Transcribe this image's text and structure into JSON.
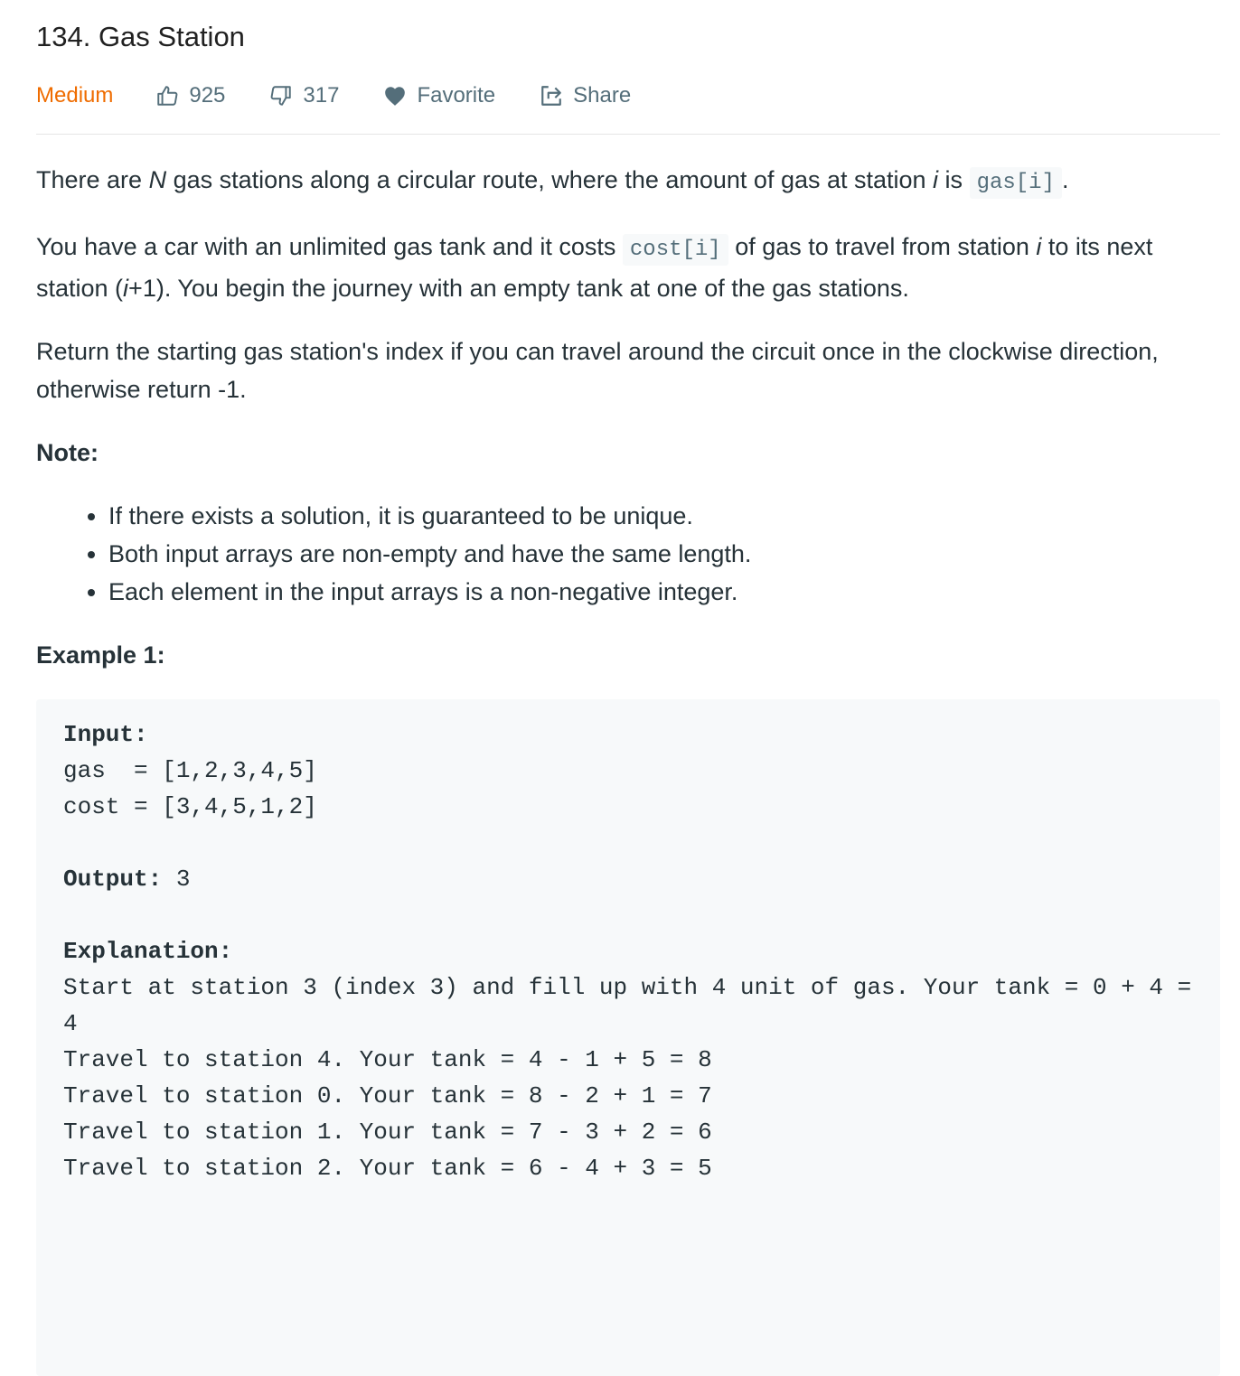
{
  "problem": {
    "title": "134. Gas Station",
    "difficulty": "Medium",
    "likes": "925",
    "dislikes": "317",
    "favorite_label": "Favorite",
    "share_label": "Share",
    "difficulty_color": "#ef6c00"
  },
  "description": {
    "p1_pre": "There are ",
    "p1_n": "N",
    "p1_mid": " gas stations along a circular route, where the amount of gas at station ",
    "p1_i": "i",
    "p1_post": " is ",
    "p1_code": "gas[i]",
    "p1_end": ".",
    "p2_pre": "You have a car with an unlimited gas tank and it costs ",
    "p2_code": "cost[i]",
    "p2_mid": " of gas to travel from station ",
    "p2_i": "i",
    "p2_mid2": " to its next station (",
    "p2_i2": "i",
    "p2_post": "+1). You begin the journey with an empty tank at one of the gas stations.",
    "p3": "Return the starting gas station's index if you can travel around the circuit once in the clockwise direction, otherwise return -1."
  },
  "note": {
    "heading": "Note:",
    "items": [
      "If there exists a solution, it is guaranteed to be unique.",
      "Both input arrays are non-empty and have the same length.",
      "Each element in the input arrays is a non-negative integer."
    ]
  },
  "example": {
    "heading": "Example 1:",
    "input_label": "Input:",
    "gas_line": "gas  = [1,2,3,4,5]",
    "cost_line": "cost = [3,4,5,1,2]",
    "output_label": "Output:",
    "output_value": " 3",
    "explanation_label": "Explanation:",
    "lines": [
      "Start at station 3 (index 3) and fill up with 4 unit of gas. Your tank = 0 + 4 = 4",
      "Travel to station 4. Your tank = 4 - 1 + 5 = 8",
      "Travel to station 0. Your tank = 8 - 2 + 1 = 7",
      "Travel to station 1. Your tank = 7 - 3 + 2 = 6",
      "Travel to station 2. Your tank = 6 - 4 + 3 = 5"
    ]
  }
}
